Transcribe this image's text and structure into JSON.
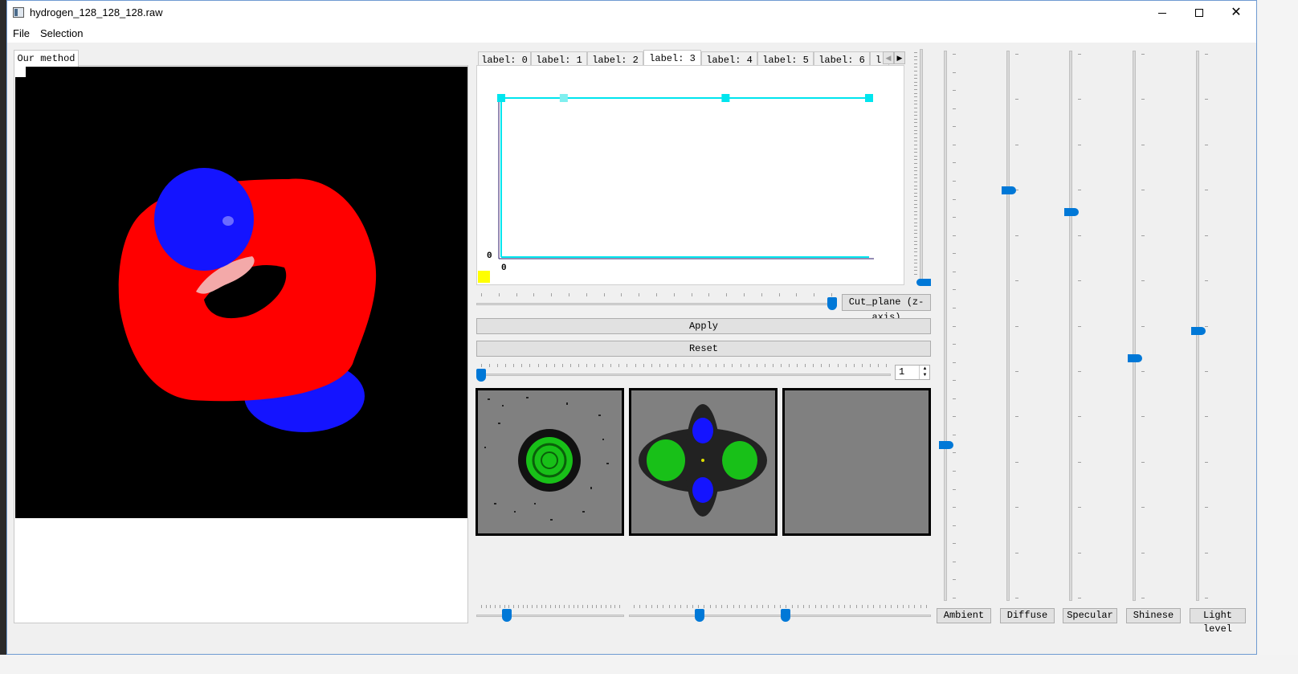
{
  "window": {
    "title": "hydrogen_128_128_128.raw",
    "minimize_icon": "minimize-icon",
    "maximize_icon": "maximize-icon",
    "close_icon": "close-icon"
  },
  "menu": {
    "file": "File",
    "selection": "Selection"
  },
  "render_view": {
    "tab_label": "Our method"
  },
  "label_tabs": {
    "items": [
      "label: 0",
      "label: 1",
      "label: 2",
      "label: 3",
      "label: 4",
      "label: 5",
      "label: 6",
      "l"
    ],
    "active_index": 3
  },
  "transfer_function": {
    "y_origin_label": "0",
    "x_origin_label": "0",
    "color_swatch": "#ffff00",
    "line_color": "#00e5ee",
    "points": [
      {
        "x": 0.0,
        "y": 1.0
      },
      {
        "x": 0.17,
        "y": 1.0
      },
      {
        "x": 0.61,
        "y": 1.0
      },
      {
        "x": 1.0,
        "y": 1.0
      }
    ]
  },
  "controls": {
    "cut_plane_label": "Cut_plane (z-axis)",
    "cut_plane_value": 1.0,
    "apply_label": "Apply",
    "reset_label": "Reset",
    "spin_value": "1",
    "slice_slider_value": 0.0
  },
  "bottom_sliders": {
    "left_value": 0.2,
    "right_values": [
      0.48,
      1.0
    ]
  },
  "lighting": {
    "labels": [
      "Ambient",
      "Diffuse",
      "Specular",
      "Shinese",
      "Light level"
    ],
    "values": [
      0.28,
      0.75,
      0.71,
      0.44,
      0.49
    ],
    "vertical_extra_value": 0.0
  },
  "colors": {
    "accent": "#0078d7",
    "red_object": "#ff0000",
    "blue_object": "#1414ff",
    "green_slice": "#22dd22"
  }
}
